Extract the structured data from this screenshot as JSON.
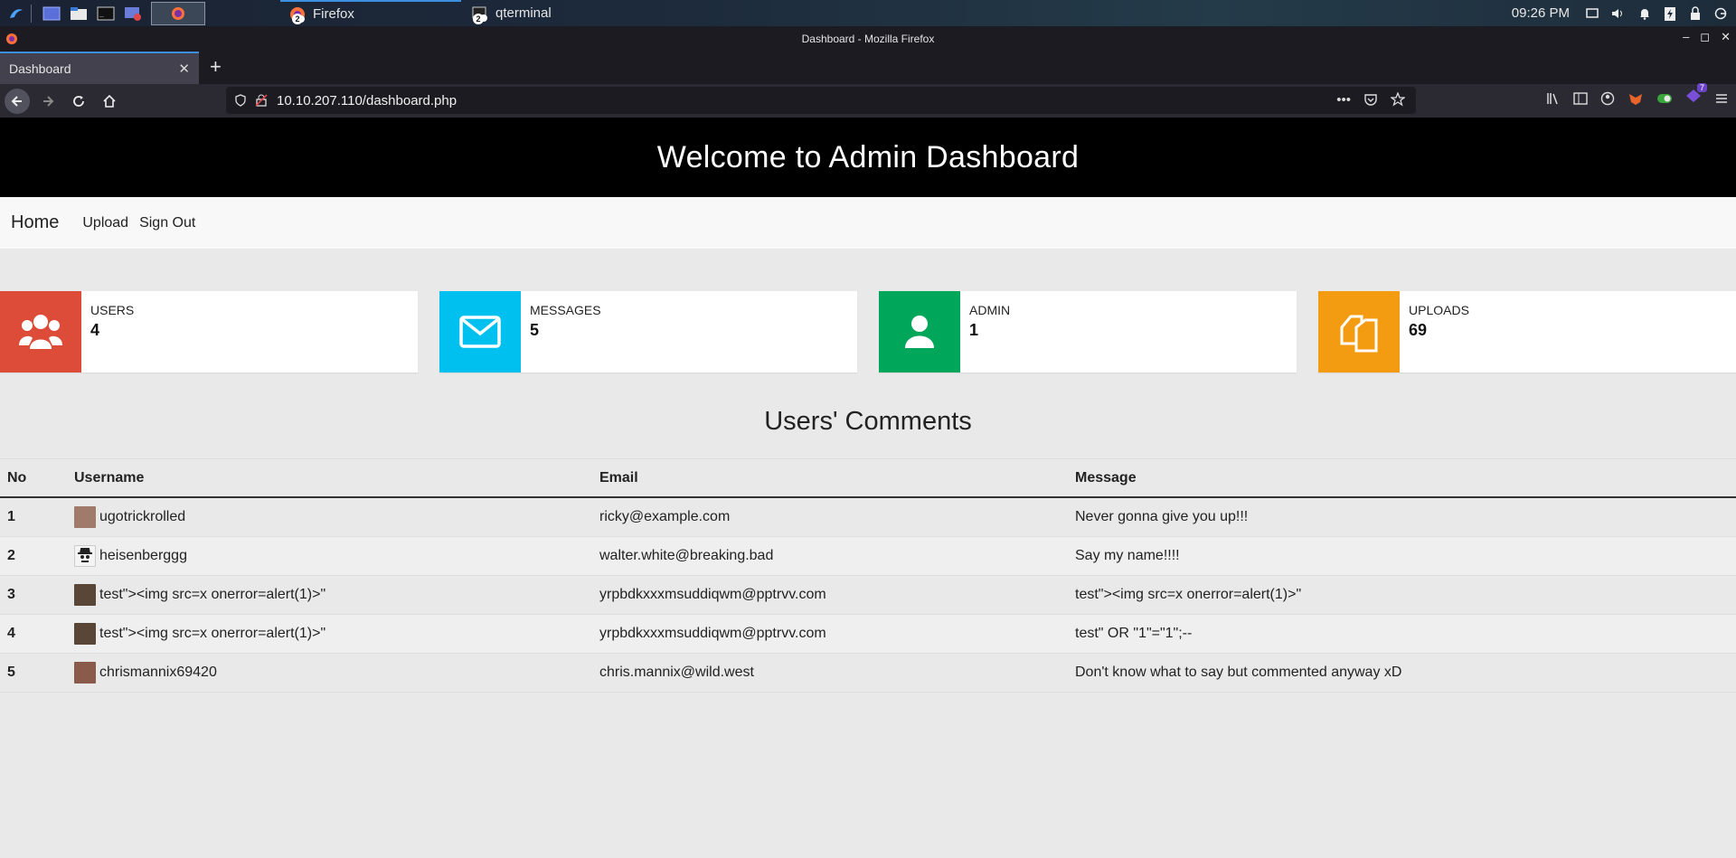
{
  "taskbar": {
    "tasks": [
      {
        "label": "Firefox",
        "badge": "2"
      },
      {
        "label": "qterminal",
        "badge": "2"
      }
    ],
    "clock": "09:26 PM",
    "colors": {
      "accent": "#3d8fe0"
    }
  },
  "browser": {
    "window_title": "Dashboard - Mozilla Firefox",
    "tab_title": "Dashboard",
    "url": "10.10.207.110/dashboard.php",
    "extension_badge": "7"
  },
  "page": {
    "header_title": "Welcome to Admin Dashboard",
    "nav": {
      "home": "Home",
      "upload": "Upload",
      "sign_out": "Sign Out"
    },
    "stats": [
      {
        "label": "USERS",
        "value": "4",
        "color": "#dd4b39",
        "icon": "users-icon"
      },
      {
        "label": "MESSAGES",
        "value": "5",
        "color": "#00c0ef",
        "icon": "envelope-icon"
      },
      {
        "label": "ADMIN",
        "value": "1",
        "color": "#00a65a",
        "icon": "user-icon"
      },
      {
        "label": "UPLOADS",
        "value": "69",
        "color": "#f39c12",
        "icon": "files-icon"
      }
    ],
    "comments_title": "Users' Comments",
    "table": {
      "headers": [
        "No",
        "Username",
        "Email",
        "Message"
      ],
      "rows": [
        {
          "no": "1",
          "username": "ugotrickrolled",
          "email": "ricky@example.com",
          "message": "Never gonna give you up!!!",
          "avatar_color": "#a07a6a"
        },
        {
          "no": "2",
          "username": "heisenberggg",
          "email": "walter.white@breaking.bad",
          "message": "Say my name!!!!",
          "avatar_color": "#222222"
        },
        {
          "no": "3",
          "username": "test\"><img src=x onerror=alert(1)>\"",
          "email": "yrpbdkxxxmsuddiqwm@pptrvv.com",
          "message": "test\"><img src=x onerror=alert(1)>\"",
          "avatar_color": "#5a4636"
        },
        {
          "no": "4",
          "username": "test\"><img src=x onerror=alert(1)>\"",
          "email": "yrpbdkxxxmsuddiqwm@pptrvv.com",
          "message": "test\" OR \"1\"=\"1\";--",
          "avatar_color": "#5a4636"
        },
        {
          "no": "5",
          "username": "chrismannix69420",
          "email": "chris.mannix@wild.west",
          "message": "Don't know what to say but commented anyway xD",
          "avatar_color": "#8a5a4a"
        }
      ]
    }
  }
}
